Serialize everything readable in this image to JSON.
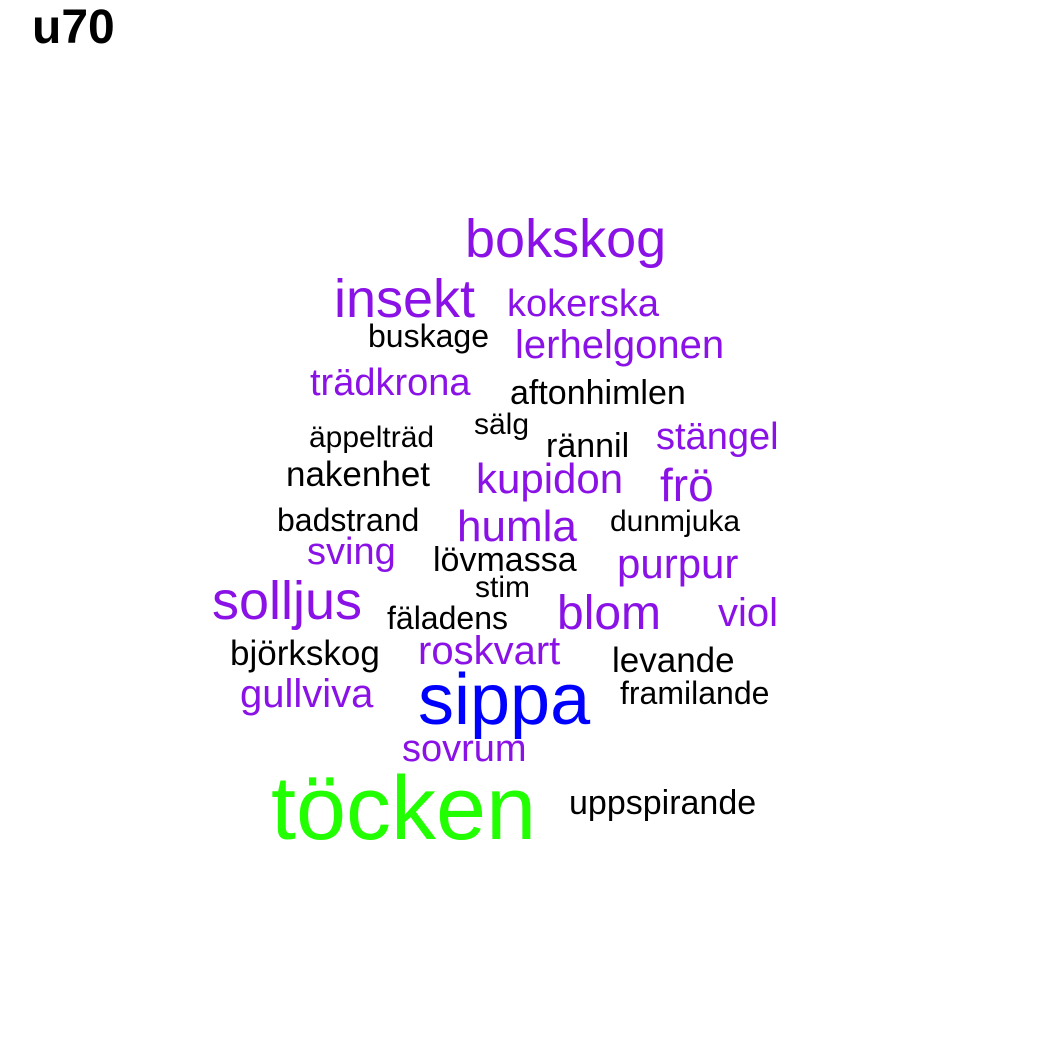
{
  "title": "u70",
  "colors": {
    "black": "#000000",
    "purple": "#8a12e6",
    "blue": "#0000ff",
    "green": "#22ff00"
  },
  "words": [
    {
      "text": "bokskog",
      "color": "purple"
    },
    {
      "text": "insekt",
      "color": "purple"
    },
    {
      "text": "kokerska",
      "color": "purple"
    },
    {
      "text": "buskage",
      "color": "black"
    },
    {
      "text": "lerhelgonen",
      "color": "purple"
    },
    {
      "text": "trädkrona",
      "color": "purple"
    },
    {
      "text": "aftonhimlen",
      "color": "black"
    },
    {
      "text": "äppelträd",
      "color": "black"
    },
    {
      "text": "sälg",
      "color": "black"
    },
    {
      "text": "rännil",
      "color": "black"
    },
    {
      "text": "stängel",
      "color": "purple"
    },
    {
      "text": "nakenhet",
      "color": "black"
    },
    {
      "text": "kupidon",
      "color": "purple"
    },
    {
      "text": "frö",
      "color": "purple"
    },
    {
      "text": "badstrand",
      "color": "black"
    },
    {
      "text": "humla",
      "color": "purple"
    },
    {
      "text": "dunmjuka",
      "color": "black"
    },
    {
      "text": "sving",
      "color": "purple"
    },
    {
      "text": "lövmassa",
      "color": "black"
    },
    {
      "text": "purpur",
      "color": "purple"
    },
    {
      "text": "stim",
      "color": "black"
    },
    {
      "text": "solljus",
      "color": "purple"
    },
    {
      "text": "fäladens",
      "color": "black"
    },
    {
      "text": "blom",
      "color": "purple"
    },
    {
      "text": "viol",
      "color": "purple"
    },
    {
      "text": "björkskog",
      "color": "black"
    },
    {
      "text": "roskvart",
      "color": "purple"
    },
    {
      "text": "levande",
      "color": "black"
    },
    {
      "text": "sippa",
      "color": "blue"
    },
    {
      "text": "gullviva",
      "color": "purple"
    },
    {
      "text": "framilande",
      "color": "black"
    },
    {
      "text": "sovrum",
      "color": "purple"
    },
    {
      "text": "töcken",
      "color": "green"
    },
    {
      "text": "uppspirande",
      "color": "black"
    }
  ]
}
